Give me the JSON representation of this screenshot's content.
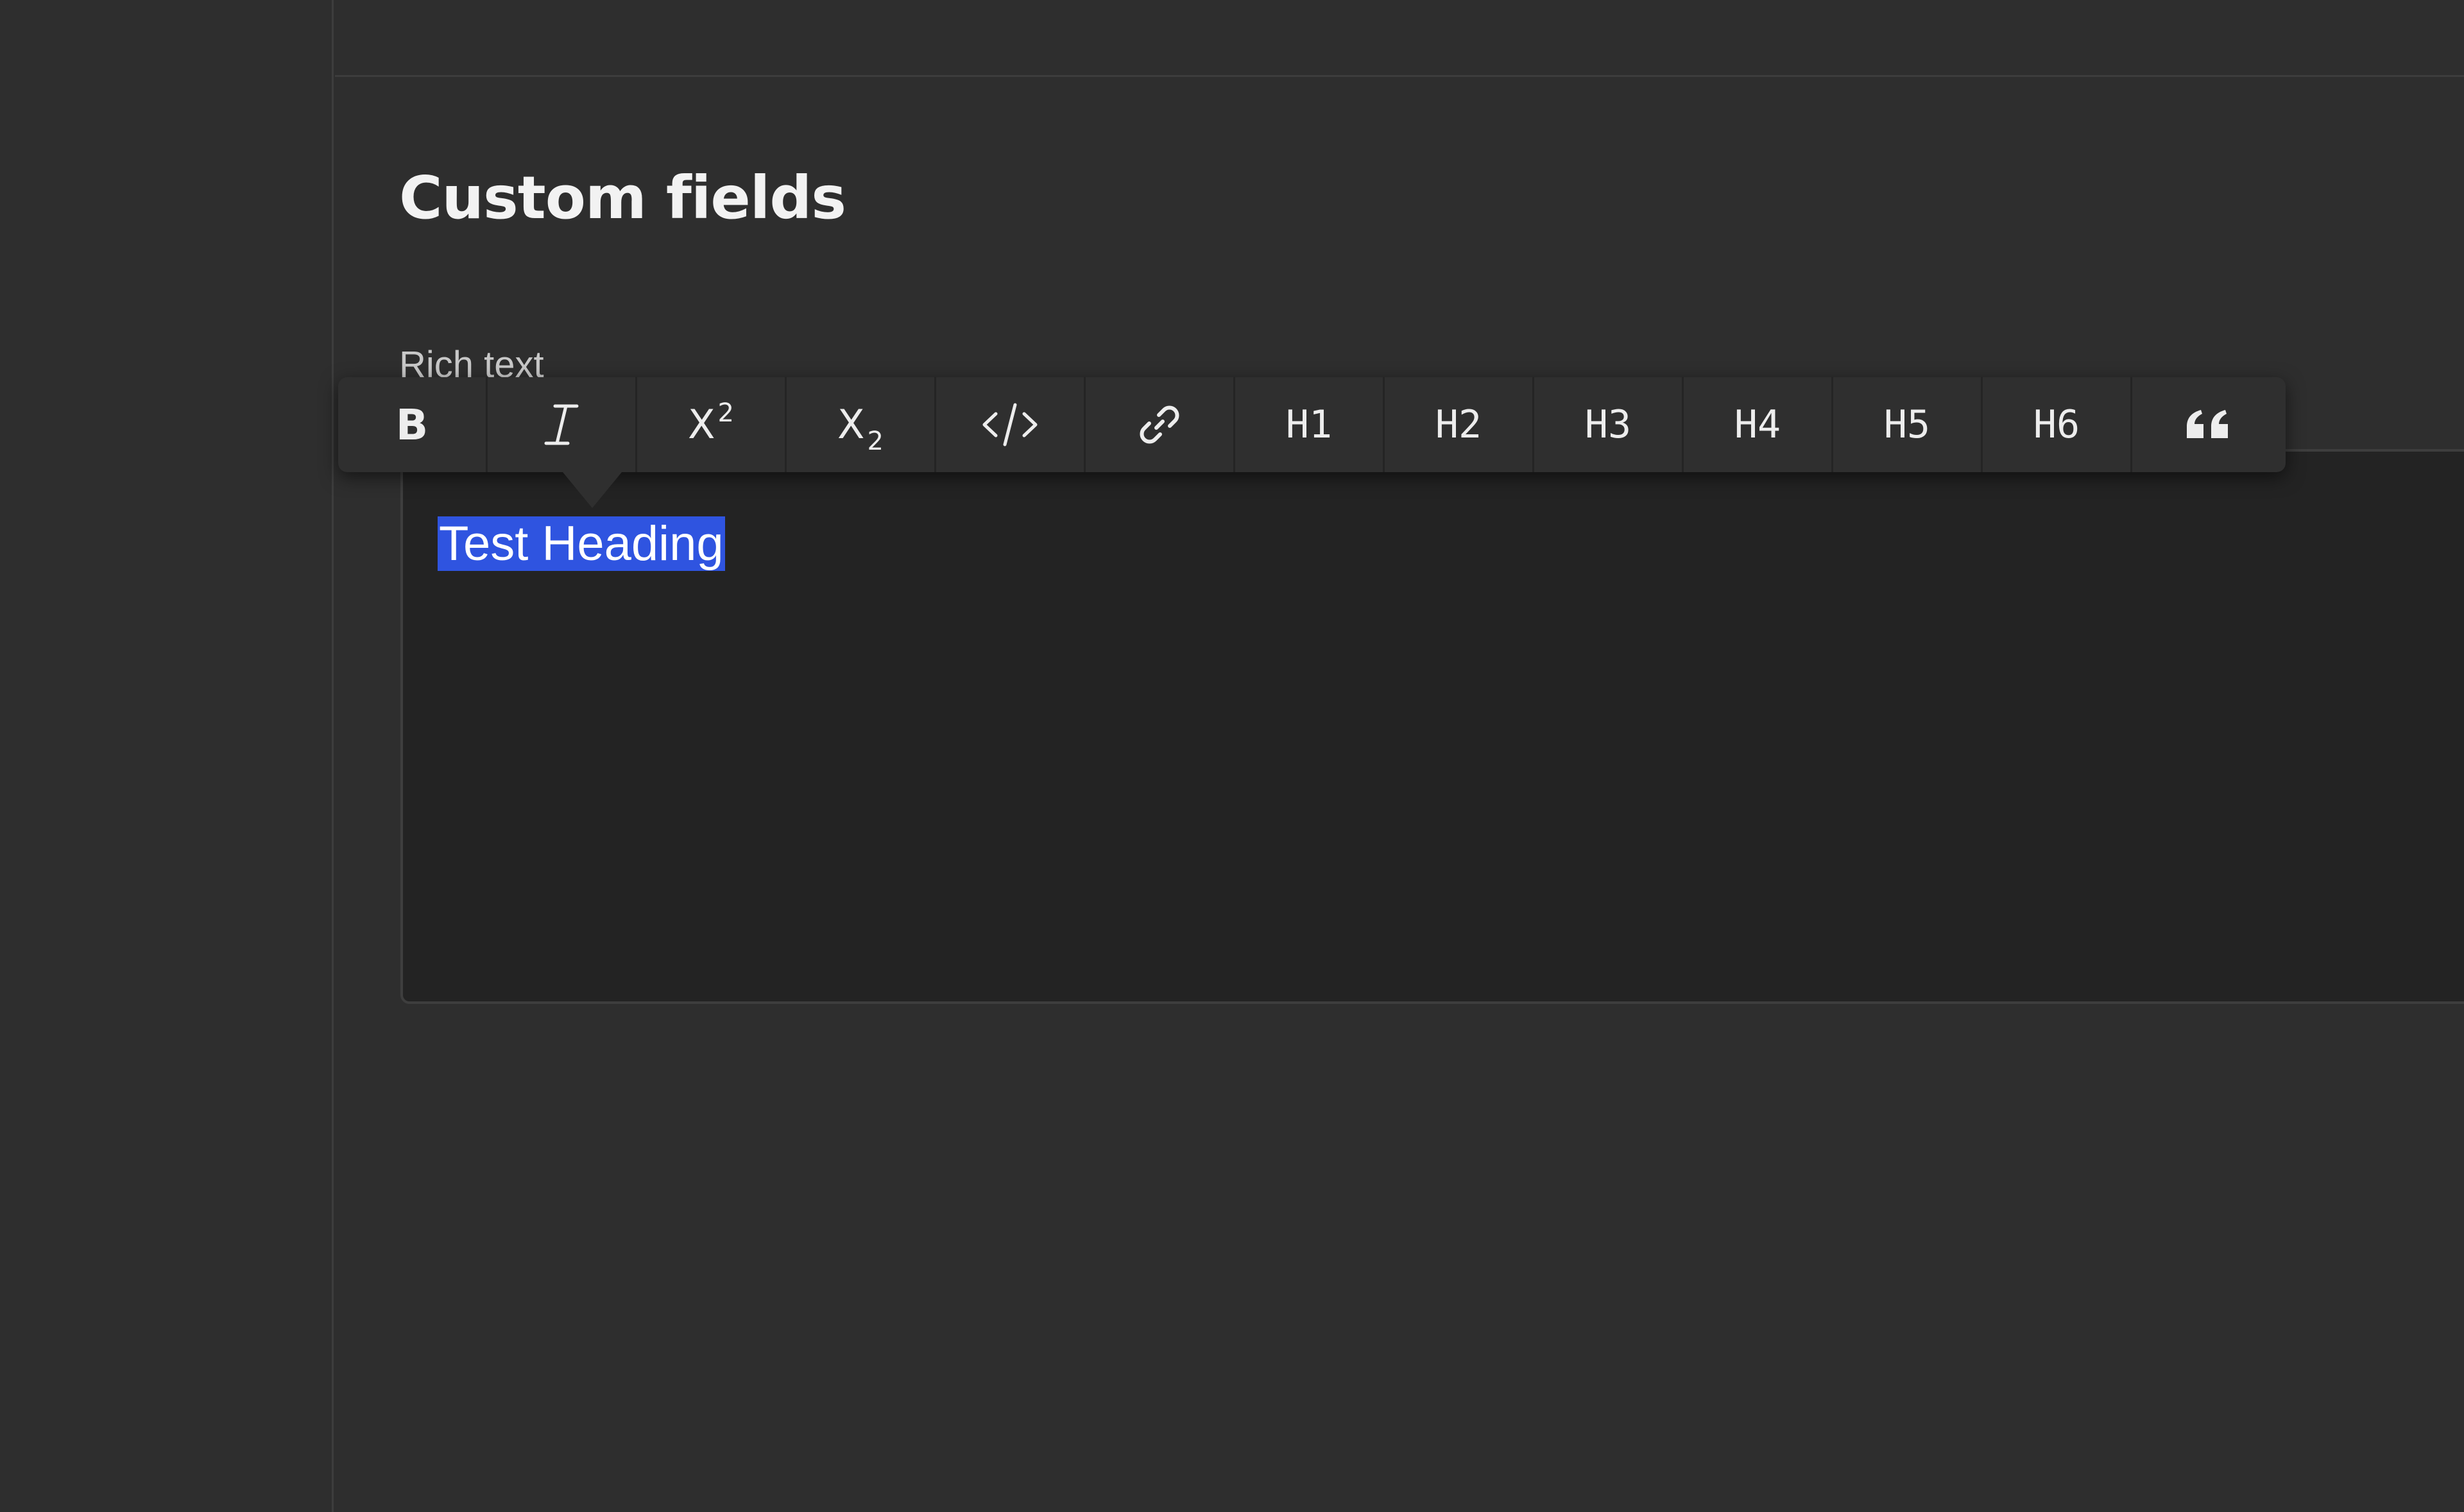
{
  "page": {
    "title": "Custom fields"
  },
  "field": {
    "label": "Rich text",
    "value": "Test Heading"
  },
  "toolbar": {
    "buttons": [
      {
        "name": "bold",
        "label": "B"
      },
      {
        "name": "italic",
        "icon": "italic-icon"
      },
      {
        "name": "superscript",
        "label": "X",
        "mark": "2"
      },
      {
        "name": "subscript",
        "label": "X",
        "mark": "2"
      },
      {
        "name": "code",
        "icon": "code-icon"
      },
      {
        "name": "link",
        "icon": "link-icon"
      },
      {
        "name": "h1",
        "label": "H1"
      },
      {
        "name": "h2",
        "label": "H2"
      },
      {
        "name": "h3",
        "label": "H3"
      },
      {
        "name": "h4",
        "label": "H4"
      },
      {
        "name": "h5",
        "label": "H5"
      },
      {
        "name": "h6",
        "label": "H6"
      },
      {
        "name": "blockquote",
        "icon": "quote-icon"
      }
    ]
  },
  "colors": {
    "background": "#2e2e2e",
    "editor_background": "#232323",
    "toolbar_background": "#2f2f2f",
    "selection": "#2f54e0",
    "text": "#f2f2f2"
  }
}
